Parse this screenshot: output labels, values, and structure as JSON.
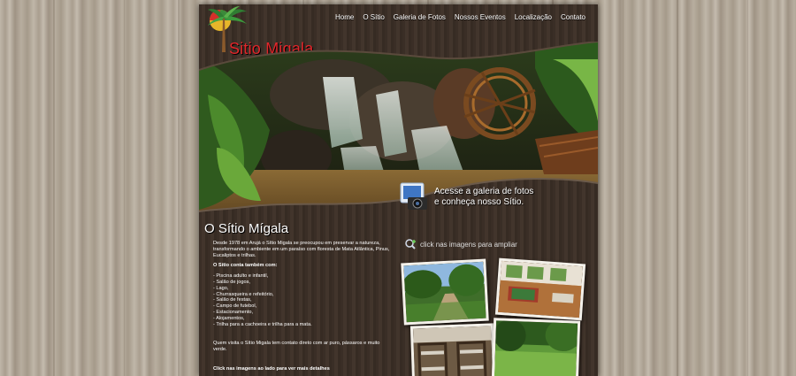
{
  "brand": {
    "name": "Sitio Migala",
    "logo_icon": "palm-tree-logo-icon"
  },
  "nav": [
    {
      "label": "Home"
    },
    {
      "label": "O Sítio"
    },
    {
      "label": "Galeria de Fotos"
    },
    {
      "label": "Nossos Eventos"
    },
    {
      "label": "Localização"
    },
    {
      "label": "Contato"
    }
  ],
  "hero": {
    "image": "waterfall-and-watermill-photo"
  },
  "gallery_cta": {
    "line1": "Acesse a galeria de fotos",
    "line2": "e conheça nosso Sítio.",
    "icon": "camera-icon"
  },
  "main": {
    "title": "O Sítio Mígala",
    "intro": "Desde 1978 em Arujá o Sítio Migala se preocupou em preservar a natureza, transformando o ambiente em um paraíso com floresta de Mata Atlântica, Pinus, Eucaliptos e trilhas.",
    "amenities_heading": "O Sítio conta também com:",
    "amenities": [
      "- Piscina adulto e infantil,",
      "- Salão de jogos,",
      "- Lago,",
      "- Churrasqueira e refeitório,",
      "- Salão de festas,",
      "- Campo de futebol,",
      "- Estacionamento,",
      "- Alojamentos,",
      "- Trilha para a cachoeira e trilha para a mata."
    ],
    "visitor_note": "Quem visita o Sítio Migala tem contato direto com ar puro, pássaros e muito verde.",
    "cta_bottom": "Click nas imagens ao lado para ver mais detalhes"
  },
  "thumbs_hint": {
    "label": "click nas imagens para ampliar",
    "icon": "zoom-plus-icon"
  },
  "thumbnails": [
    {
      "name": "forest-road-photo"
    },
    {
      "name": "game-room-photo"
    },
    {
      "name": "dormitory-bunk-beds-photo"
    },
    {
      "name": "lawn-trees-photo"
    }
  ],
  "colors": {
    "brand_red": "#e2262a",
    "nav_text": "#ffffff",
    "panel_wood": "#3a2e26"
  }
}
